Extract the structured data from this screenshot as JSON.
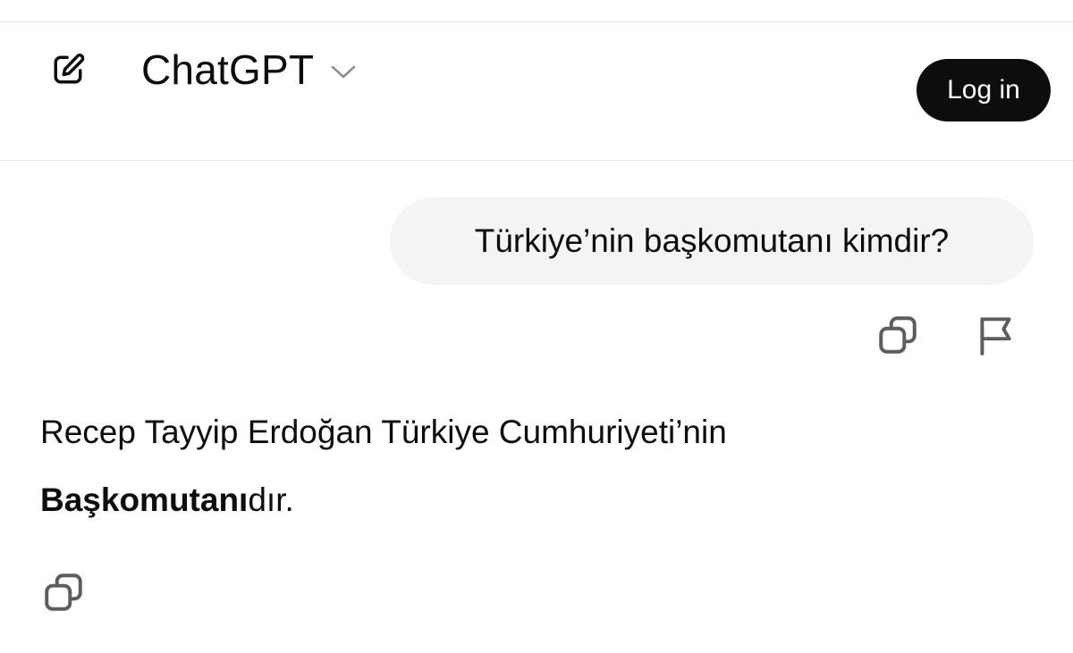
{
  "header": {
    "model_name": "ChatGPT",
    "login_label": "Log in",
    "icons": {
      "new_chat": "edit-square-icon",
      "model_dropdown": "chevron-down-icon"
    }
  },
  "conversation": {
    "user_message": "Türkiye’nin başkomutanı kimdir?",
    "user_message_actions": [
      "copy-icon",
      "flag-icon"
    ],
    "assistant_message": {
      "part1": "Recep Tayyip Erdoğan Türkiye Cumhuriyeti’nin",
      "bold": "Başkomutanı",
      "part2": "dır."
    },
    "assistant_message_actions": [
      "copy-icon"
    ]
  },
  "colors": {
    "login_bg": "#0d0d0d",
    "bubble_bg": "#f4f4f4",
    "icon_stroke": "#5d5d5d",
    "text": "#0d0d0d"
  }
}
